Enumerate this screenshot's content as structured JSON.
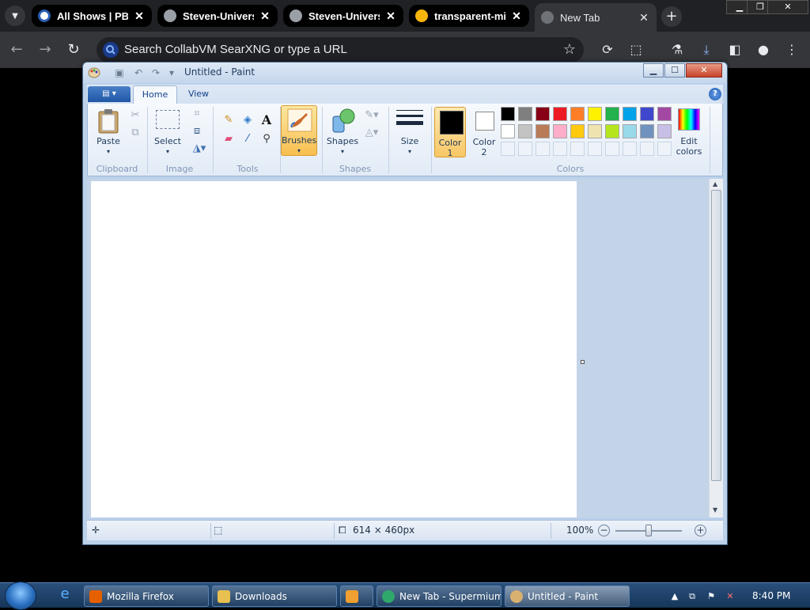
{
  "browser": {
    "tabs": [
      {
        "label": "All Shows | PBS",
        "favicon": "pbs-icon"
      },
      {
        "label": "Steven-Universe",
        "favicon": "globe-icon"
      },
      {
        "label": "Steven-Universe",
        "favicon": "globe-icon"
      },
      {
        "label": "transparent-mic",
        "favicon": "png-icon"
      },
      {
        "label": "New Tab",
        "favicon": "globe-icon"
      }
    ],
    "active_tab": 4,
    "omnibox_placeholder": "Search CollabVM SearXNG or type a URL",
    "tab_close_glyph": "✕",
    "new_tab_glyph": "+"
  },
  "paint": {
    "title": "Untitled - Paint",
    "ribbon_tabs": [
      "Home",
      "View"
    ],
    "active_ribbon_tab": "Home",
    "groups": {
      "clipboard": {
        "label": "Clipboard",
        "paste": "Paste"
      },
      "image": {
        "label": "Image",
        "select": "Select"
      },
      "tools": {
        "label": "Tools",
        "text_glyph": "A"
      },
      "brushes": {
        "label": "Brushes"
      },
      "shapes": {
        "label": "Shapes",
        "shapes": "Shapes"
      },
      "size": {
        "label": "Size"
      },
      "colors": {
        "label": "Colors",
        "color1": "Color 1",
        "color1_value": "#000000",
        "color2": "Color 2",
        "color2_value": "#ffffff",
        "edit_colors": "Edit colors",
        "palette_row1": [
          "#000000",
          "#7f7f7f",
          "#880015",
          "#ed1c24",
          "#ff7f27",
          "#fff200",
          "#22b14c",
          "#00a2e8",
          "#3f48cc",
          "#a349a4"
        ],
        "palette_row2": [
          "#ffffff",
          "#c3c3c3",
          "#b97a57",
          "#ffaec9",
          "#ffc90e",
          "#efe4b0",
          "#b5e61d",
          "#99d9ea",
          "#7092be",
          "#c8bfe7"
        ]
      }
    },
    "status": {
      "image_size": "614 × 460px",
      "zoom": "100%"
    }
  },
  "taskbar": {
    "buttons": [
      {
        "label": "Mozilla Firefox",
        "icon": "firefox-icon",
        "color": "#e66000"
      },
      {
        "label": "Downloads",
        "icon": "folder-icon",
        "color": "#e8c050"
      },
      {
        "label": "",
        "icon": "media-player-icon",
        "color": "#f0a030"
      },
      {
        "label": "New Tab - Supermium",
        "icon": "supermium-icon",
        "color": "#2fa96b"
      },
      {
        "label": "Untitled - Paint",
        "icon": "paint-icon",
        "color": "#d8b070"
      }
    ],
    "clock": "8:40 PM"
  },
  "colors": {
    "chrome_dark": "#202124",
    "chrome_toolbar": "#35363a",
    "aero_blue": "#bcd1ea",
    "taskbar": "#1c4068",
    "highlight_orange": "#f8c765"
  }
}
